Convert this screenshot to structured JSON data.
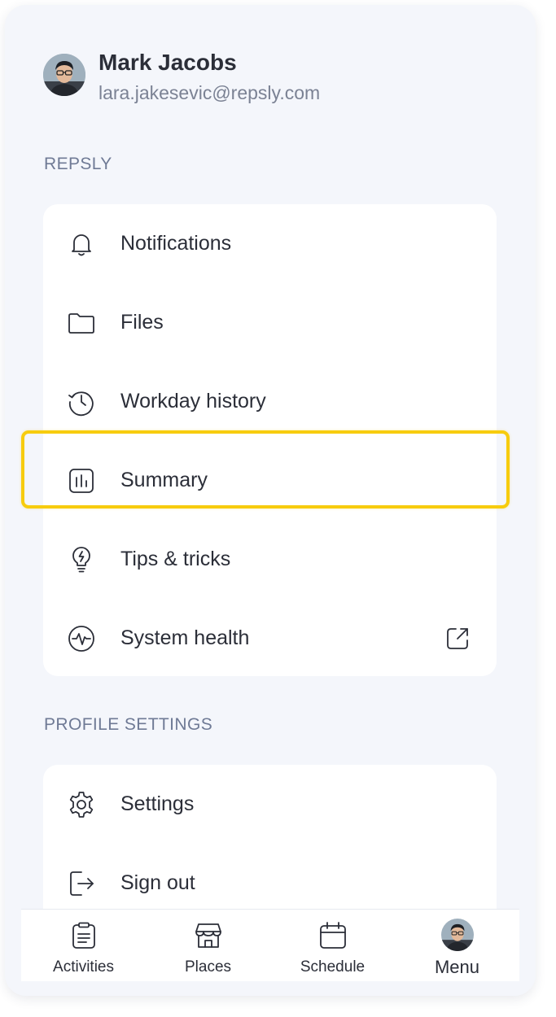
{
  "profile": {
    "name": "Mark Jacobs",
    "email": "lara.jakesevic@repsly.com",
    "avatar_icon": "user-avatar"
  },
  "sections": {
    "repsly": {
      "title": "REPSLY",
      "items": [
        {
          "label": "Notifications",
          "icon": "bell-icon"
        },
        {
          "label": "Files",
          "icon": "folder-icon"
        },
        {
          "label": "Workday history",
          "icon": "history-icon"
        },
        {
          "label": "Summary",
          "icon": "chart-icon"
        },
        {
          "label": "Tips & tricks",
          "icon": "lightbulb-icon"
        },
        {
          "label": "System health",
          "icon": "pulse-icon",
          "trailing_icon": "external-link-icon"
        }
      ]
    },
    "profile_settings": {
      "title": "PROFILE SETTINGS",
      "items": [
        {
          "label": "Settings",
          "icon": "gear-icon"
        },
        {
          "label": "Sign out",
          "icon": "sign-out-icon"
        }
      ]
    }
  },
  "highlight_color": "#f7cc0e",
  "tabbar": {
    "tabs": [
      {
        "label": "Activities",
        "icon": "clipboard-icon"
      },
      {
        "label": "Places",
        "icon": "store-icon"
      },
      {
        "label": "Schedule",
        "icon": "calendar-icon"
      },
      {
        "label": "Menu",
        "icon": "user-avatar",
        "active": true
      }
    ]
  }
}
